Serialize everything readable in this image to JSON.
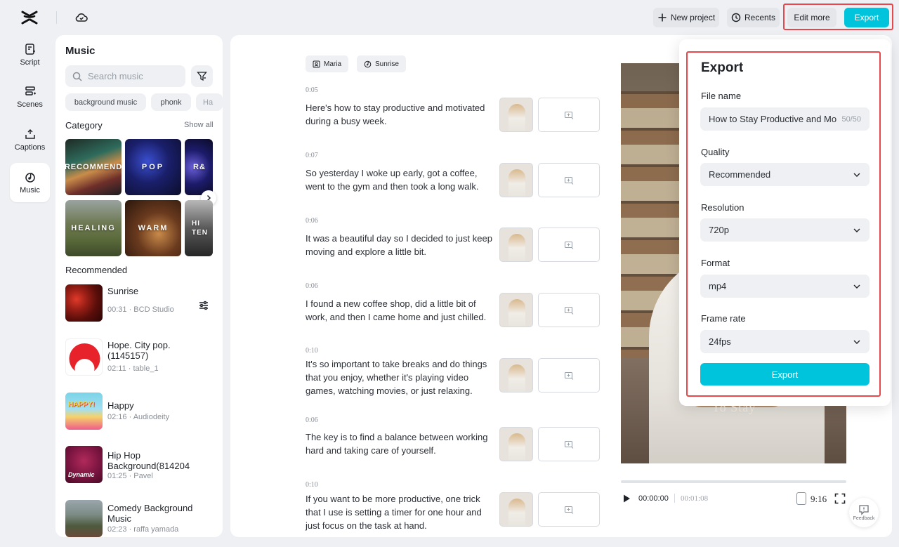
{
  "topbar": {
    "new_project": "New project",
    "recents": "Recents",
    "edit_more": "Edit more",
    "export": "Export"
  },
  "nav": [
    {
      "label": "Script",
      "icon": "script-icon"
    },
    {
      "label": "Scenes",
      "icon": "scenes-icon"
    },
    {
      "label": "Captions",
      "icon": "captions-icon"
    },
    {
      "label": "Music",
      "icon": "music-icon",
      "active": true
    }
  ],
  "music": {
    "title": "Music",
    "search_placeholder": "Search music",
    "chips": [
      "background music",
      "phonk",
      "Ha"
    ],
    "category_title": "Category",
    "show_all": "Show all",
    "categories": [
      "RECOMMEND",
      "POP",
      "R&",
      "HEALING",
      "WARM",
      "HI TEN"
    ],
    "recommended_title": "Recommended",
    "tracks": [
      {
        "name": "Sunrise",
        "meta": "00:31 · BCD Studio"
      },
      {
        "name": "Hope. City pop.(1145157)",
        "meta": "02:11 · table_1"
      },
      {
        "name": "Happy",
        "meta": "02:16 · Audiodeity",
        "thumb_text": "HAPPY!"
      },
      {
        "name": "Hip Hop Background(814204",
        "meta": "01:25 · Pavel",
        "thumb_text": "Dynamic"
      },
      {
        "name": "Comedy Background Music",
        "meta": "02:23 · raffa yamada"
      }
    ]
  },
  "script": {
    "speakers": [
      "Maria",
      "Sunrise"
    ],
    "segments": [
      {
        "time": "0:05",
        "text": "Here's how to stay productive and motivated during a busy week."
      },
      {
        "time": "0:07",
        "text": "So yesterday I woke up early, got a coffee, went to the gym and then took a long walk."
      },
      {
        "time": "0:06",
        "text": "It was a beautiful day so I decided to just keep moving and explore a little bit."
      },
      {
        "time": "0:06",
        "text": "I found a new coffee shop, did a little bit of work, and then I came home and just chilled."
      },
      {
        "time": "0:10",
        "text": "It's so important to take breaks and do things that you enjoy, whether it's playing video games, watching movies, or just relaxing."
      },
      {
        "time": "0:06",
        "text": "The key is to find a balance between working hard and taking care of yourself."
      },
      {
        "time": "0:10",
        "text": "If you want to be more productive, one trick that I use is setting a timer for one hour and just focus on the task at hand."
      }
    ]
  },
  "preview": {
    "overlay_text": "To Stay",
    "current_time": "00:00:00",
    "total_time": "00:01:08",
    "ratio": "9:16",
    "progress": 0
  },
  "feedback": "Feedback",
  "export_panel": {
    "title": "Export",
    "file_name_label": "File name",
    "file_name_value": "How to Stay Productive and Mo",
    "file_name_count": "50/50",
    "quality_label": "Quality",
    "quality_value": "Recommended",
    "resolution_label": "Resolution",
    "resolution_value": "720p",
    "format_label": "Format",
    "format_value": "mp4",
    "frame_rate_label": "Frame rate",
    "frame_rate_value": "24fps",
    "export_button": "Export"
  },
  "colors": {
    "accent": "#00c4dc",
    "highlight": "#e5484d"
  }
}
